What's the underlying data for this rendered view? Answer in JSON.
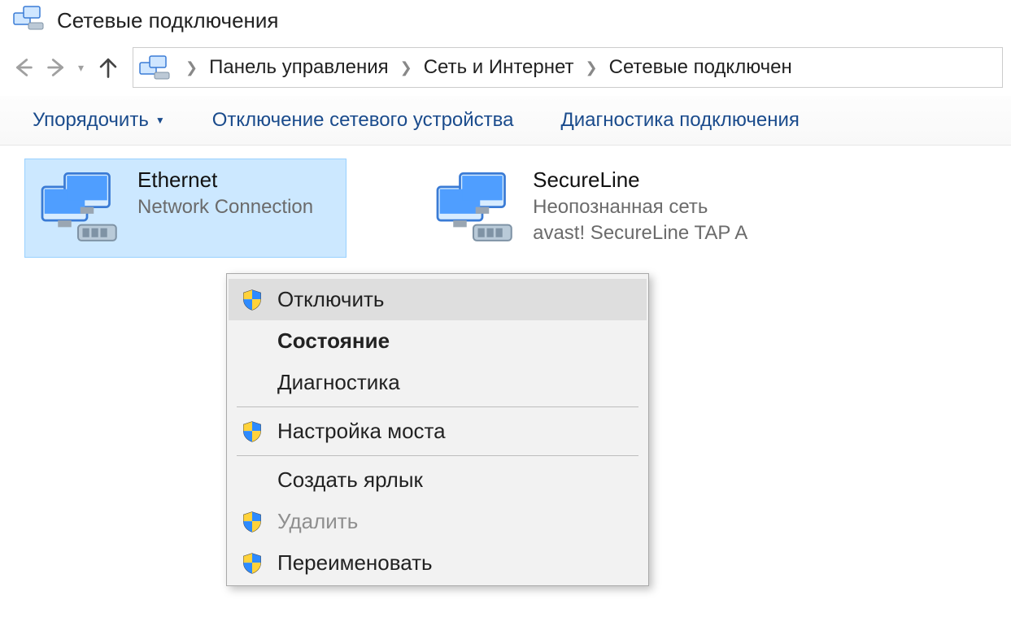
{
  "title": "Сетевые подключения",
  "breadcrumb": {
    "parts": [
      "Панель управления",
      "Сеть и Интернет",
      "Сетевые подключен"
    ]
  },
  "toolbar": {
    "organize": "Упорядочить",
    "disable_device": "Отключение сетевого устройства",
    "diagnose": "Диагностика подключения"
  },
  "connections": [
    {
      "name": "Ethernet",
      "line2": "Network Connection",
      "line3": "",
      "selected": true
    },
    {
      "name": "SecureLine",
      "line2": "Неопознанная сеть",
      "line3": "avast! SecureLine TAP A",
      "selected": false
    }
  ],
  "context_menu": {
    "items": [
      {
        "label": "Отключить",
        "shield": true,
        "hover": true,
        "bold": false,
        "disabled": false
      },
      {
        "label": "Состояние",
        "shield": false,
        "hover": false,
        "bold": true,
        "disabled": false
      },
      {
        "label": "Диагностика",
        "shield": false,
        "hover": false,
        "bold": false,
        "disabled": false
      },
      {
        "sep": true
      },
      {
        "label": "Настройка моста",
        "shield": true,
        "hover": false,
        "bold": false,
        "disabled": false
      },
      {
        "sep": true
      },
      {
        "label": "Создать ярлык",
        "shield": false,
        "hover": false,
        "bold": false,
        "disabled": false
      },
      {
        "label": "Удалить",
        "shield": true,
        "hover": false,
        "bold": false,
        "disabled": true
      },
      {
        "label": "Переименовать",
        "shield": true,
        "hover": false,
        "bold": false,
        "disabled": false
      }
    ]
  }
}
